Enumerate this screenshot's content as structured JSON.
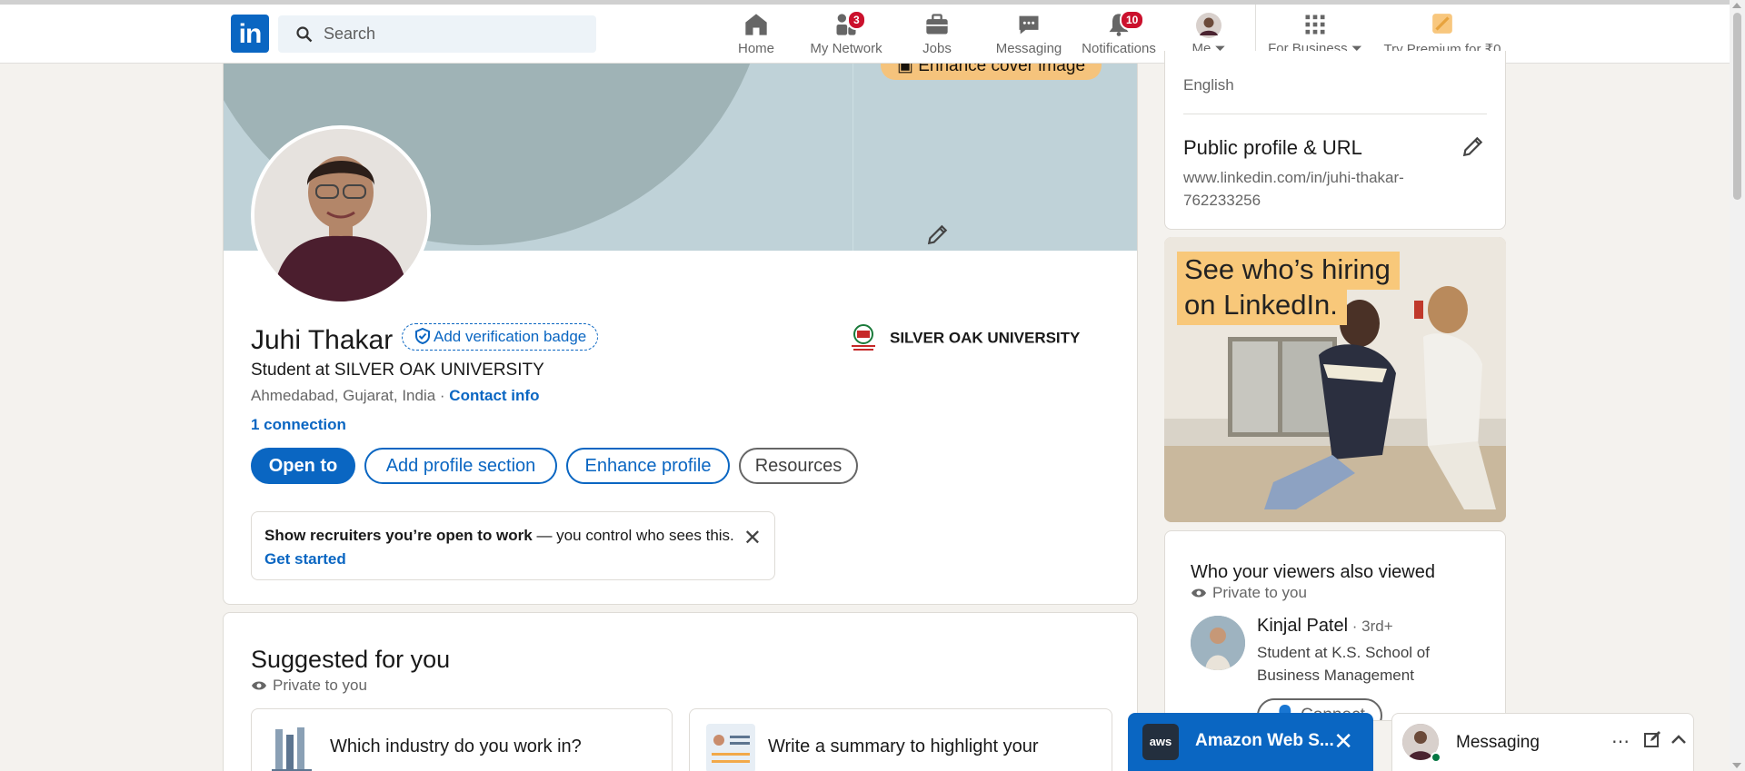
{
  "nav": {
    "search_placeholder": "Search",
    "items": [
      {
        "label": "Home",
        "icon": "home-icon"
      },
      {
        "label": "My Network",
        "icon": "network-icon",
        "badge": "3"
      },
      {
        "label": "Jobs",
        "icon": "briefcase-icon"
      },
      {
        "label": "Messaging",
        "icon": "chat-icon"
      },
      {
        "label": "Notifications",
        "icon": "bell-icon",
        "badge": "10"
      },
      {
        "label": "Me",
        "icon": "avatar"
      },
      {
        "label": "For Business",
        "icon": "grid-icon"
      },
      {
        "label": "Try Premium for ₹0",
        "icon": "premium-icon"
      }
    ]
  },
  "profile": {
    "enhance_cover": "Enhance cover image",
    "name": "Juhi Thakar",
    "verification": "Add verification badge",
    "headline": "Student at SILVER OAK UNIVERSITY",
    "location": "Ahmedabad, Gujarat, India · ",
    "contact_info": "Contact info",
    "connections": "1 connection",
    "university": "SILVER OAK UNIVERSITY",
    "buttons": {
      "open_to": "Open to",
      "add_section": "Add profile section",
      "enhance": "Enhance profile",
      "resources": "Resources"
    },
    "open_to_work": {
      "bold": "Show recruiters you’re open to work",
      "rest": " — you control who sees this.",
      "cta": "Get started"
    }
  },
  "suggested": {
    "title": "Suggested for you",
    "private": "Private to you",
    "items": [
      "Which industry do you work in?",
      "Write a summary to highlight your"
    ]
  },
  "sidebar": {
    "language": "English",
    "public_profile_title": "Public profile & URL",
    "public_profile_url": "www.linkedin.com/in/juhi-thakar-762233256"
  },
  "ad": {
    "line1": "See who’s hiring",
    "line2": "on LinkedIn."
  },
  "viewers": {
    "title": "Who your viewers also viewed",
    "private": "Private to you",
    "person_name": "Kinjal Patel",
    "person_degree": " · 3rd+",
    "person_desc": "Student at K.S. School of Business Management",
    "connect": "Connect"
  },
  "bottom": {
    "aws_label": "Amazon Web S...",
    "aws_logo": "aws",
    "messaging_label": "Messaging"
  }
}
